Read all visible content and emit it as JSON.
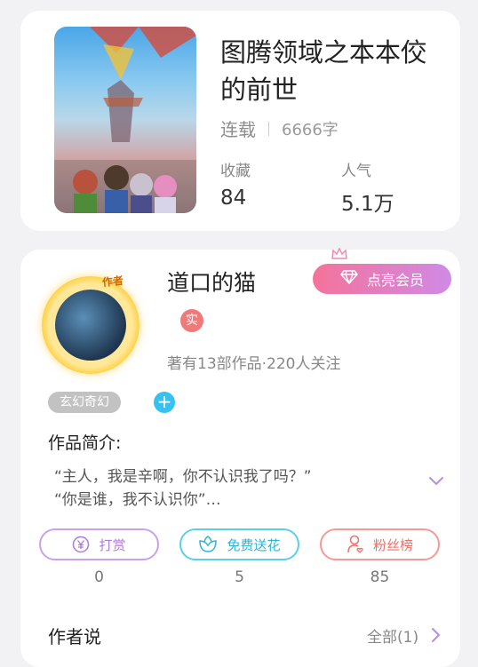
{
  "book": {
    "title": "图腾领域之本本佼的前世",
    "status": "连载",
    "word_count": "6666字",
    "stats": [
      {
        "label": "收藏",
        "value": "84"
      },
      {
        "label": "人气",
        "value": "5.1万"
      }
    ]
  },
  "author": {
    "name": "道口的猫",
    "avatar_tag": "作者",
    "verified_badge": "实",
    "info": "著有13部作品·220人关注",
    "vip_button": "点亮会员",
    "genre_tag": "玄幻奇幻",
    "add_tag_symbol": "+"
  },
  "intro": {
    "title": "作品简介:",
    "lines": [
      "“主人，我是辛啊，你不认识我了吗？”",
      "“你是谁，我不认识你”…"
    ]
  },
  "actions": [
    {
      "label": "打赏",
      "count": "0",
      "icon": "yen-coin-icon",
      "color": "#b07ad8"
    },
    {
      "label": "免费送花",
      "count": "5",
      "icon": "flower-icon",
      "color": "#29b5d8"
    },
    {
      "label": "粉丝榜",
      "count": "85",
      "icon": "fan-user-icon",
      "color": "#ec6f6a"
    }
  ],
  "author_say": {
    "title": "作者说",
    "all_link": "全部(1)"
  },
  "colors": {
    "background": "#f2f2f4",
    "vip_gradient_start": "#f4739a",
    "vip_gradient_end": "#d08ae6",
    "genre_tag": "#c2c2c2",
    "add_tag": "#36c2f0"
  }
}
